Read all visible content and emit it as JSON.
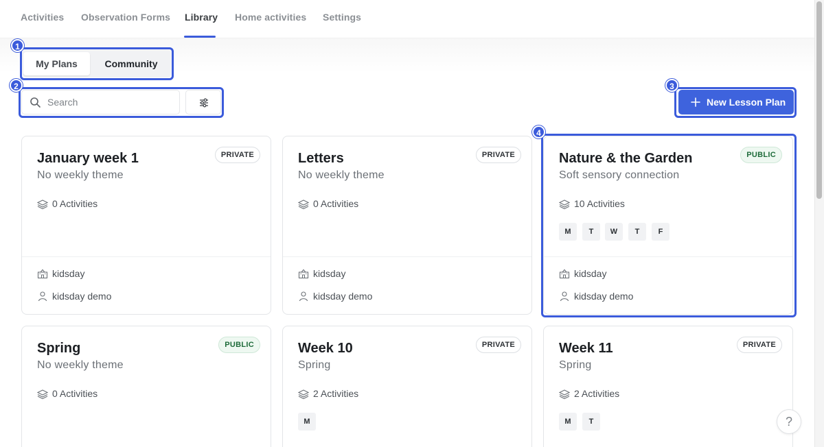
{
  "nav": {
    "tabs": [
      {
        "label": "Activities"
      },
      {
        "label": "Observation Forms"
      },
      {
        "label": "Library"
      },
      {
        "label": "Home activities"
      },
      {
        "label": "Settings"
      }
    ],
    "active": "Library"
  },
  "segmented": {
    "my_plans": "My Plans",
    "community": "Community",
    "selected": "My Plans"
  },
  "search": {
    "placeholder": "Search",
    "value": ""
  },
  "new_button": {
    "label": "New Lesson Plan"
  },
  "annotations": [
    "1",
    "2",
    "3",
    "4"
  ],
  "cards": [
    {
      "title": "January week 1",
      "subtitle": "No weekly theme",
      "visibility": "PRIVATE",
      "activities": "0 Activities",
      "days": [],
      "school": "kidsday",
      "author": "kidsday demo"
    },
    {
      "title": "Letters",
      "subtitle": "No weekly theme",
      "visibility": "PRIVATE",
      "activities": "0 Activities",
      "days": [],
      "school": "kidsday",
      "author": "kidsday demo"
    },
    {
      "title": "Nature & the Garden",
      "subtitle": "Soft sensory connection",
      "visibility": "PUBLIC",
      "activities": "10 Activities",
      "days": [
        "M",
        "T",
        "W",
        "T",
        "F"
      ],
      "school": "kidsday",
      "author": "kidsday demo"
    },
    {
      "title": "Spring",
      "subtitle": "No weekly theme",
      "visibility": "PUBLIC",
      "activities": "0 Activities",
      "days": [],
      "school": "",
      "author": ""
    },
    {
      "title": "Week 10",
      "subtitle": "Spring",
      "visibility": "PRIVATE",
      "activities": "2 Activities",
      "days": [
        "M"
      ],
      "school": "",
      "author": ""
    },
    {
      "title": "Week 11",
      "subtitle": "Spring",
      "visibility": "PRIVATE",
      "activities": "2 Activities",
      "days": [
        "M",
        "T"
      ],
      "school": "",
      "author": ""
    }
  ],
  "help": {
    "label": "?"
  },
  "colors": {
    "accent": "#3e63dd",
    "annotation": "#3b5bdb",
    "public_badge": "#1e6b3a"
  }
}
